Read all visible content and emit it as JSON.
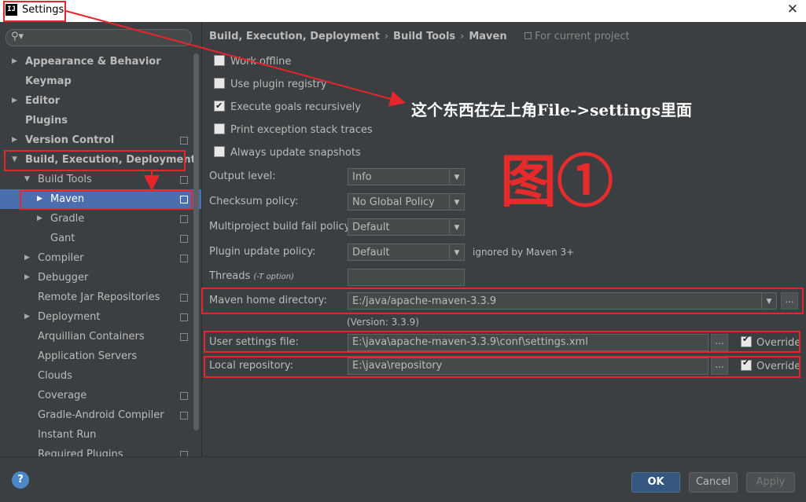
{
  "window": {
    "title": "Settings"
  },
  "search": {
    "placeholder": ""
  },
  "sidebar": {
    "items": [
      {
        "label": "Appearance & Behavior",
        "bold": true,
        "arrow": "right"
      },
      {
        "label": "Keymap",
        "bold": true
      },
      {
        "label": "Editor",
        "bold": true,
        "arrow": "right"
      },
      {
        "label": "Plugins",
        "bold": true
      },
      {
        "label": "Version Control",
        "bold": true,
        "arrow": "right",
        "project": true
      },
      {
        "label": "Build, Execution, Deployment",
        "bold": true,
        "arrow": "down"
      },
      {
        "label": "Build Tools",
        "arrow": "down",
        "project": true
      },
      {
        "label": "Maven",
        "arrow": "right",
        "project": true,
        "selected": true
      },
      {
        "label": "Gradle",
        "arrow": "right",
        "project": true
      },
      {
        "label": "Gant",
        "project": true
      },
      {
        "label": "Compiler",
        "arrow": "right",
        "project": true
      },
      {
        "label": "Debugger",
        "arrow": "right"
      },
      {
        "label": "Remote Jar Repositories",
        "project": true
      },
      {
        "label": "Deployment",
        "arrow": "right",
        "project": true
      },
      {
        "label": "Arquillian Containers",
        "project": true
      },
      {
        "label": "Application Servers"
      },
      {
        "label": "Clouds"
      },
      {
        "label": "Coverage",
        "project": true
      },
      {
        "label": "Gradle-Android Compiler",
        "project": true
      },
      {
        "label": "Instant Run"
      },
      {
        "label": "Required Plugins",
        "project": true
      }
    ]
  },
  "breadcrumb": {
    "parts": [
      "Build, Execution, Deployment",
      "Build Tools",
      "Maven"
    ],
    "separator": "›",
    "scope": "For current project"
  },
  "options": {
    "work_offline": {
      "label": "Work offline",
      "checked": false
    },
    "use_plugin_registry": {
      "label": "Use plugin registry",
      "checked": false
    },
    "execute_goals_recursively": {
      "label": "Execute goals recursively",
      "checked": true
    },
    "print_exception_stack_traces": {
      "label": "Print exception stack traces",
      "checked": false
    },
    "always_update_snapshots": {
      "label": "Always update snapshots",
      "checked": false
    }
  },
  "fields": {
    "output_level": {
      "label": "Output level:",
      "value": "Info"
    },
    "checksum_policy": {
      "label": "Checksum policy:",
      "value": "No Global Policy"
    },
    "multiproject_fail_policy": {
      "label": "Multiproject build fail policy:",
      "value": "Default"
    },
    "plugin_update_policy": {
      "label": "Plugin update policy:",
      "value": "Default",
      "note": "ignored by Maven 3+"
    },
    "threads": {
      "label": "Threads",
      "hint": "(-T option)",
      "value": ""
    },
    "maven_home": {
      "label": "Maven home directory:",
      "value": "E:/java/apache-maven-3.3.9",
      "version": "(Version: 3.3.9)"
    },
    "user_settings": {
      "label": "User settings file:",
      "value": "E:\\java\\apache-maven-3.3.9\\conf\\settings.xml",
      "override_label": "Override",
      "override": true
    },
    "local_repository": {
      "label": "Local repository:",
      "value": "E:\\java\\repository",
      "override_label": "Override",
      "override": true
    },
    "browse_label": "..."
  },
  "annotations": {
    "note": "这个东西在左上角File->settings里面",
    "figure": "图①",
    "color": "#e8242c"
  },
  "footer": {
    "help": "?",
    "ok": "OK",
    "cancel": "Cancel",
    "apply": "Apply"
  },
  "colors": {
    "background": "#3c3f41",
    "selection": "#4b6eaf",
    "accent_ok": "#365880",
    "annotation": "#e8242c"
  }
}
